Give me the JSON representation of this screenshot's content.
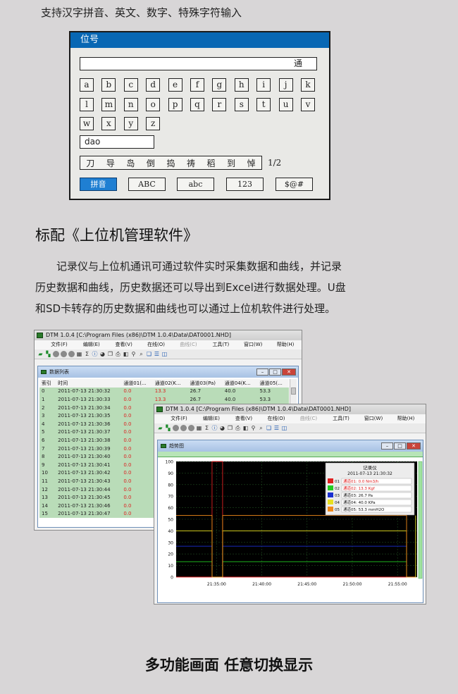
{
  "top_caption": "支持汉字拼音、英文、数字、特殊字符输入",
  "keyboard": {
    "title": "位号",
    "input_value": "通",
    "row1": [
      "a",
      "b",
      "c",
      "d",
      "e",
      "f",
      "g",
      "h",
      "i",
      "j",
      "k"
    ],
    "row2": [
      "l",
      "m",
      "n",
      "o",
      "p",
      "q",
      "r",
      "s",
      "t",
      "u",
      "v"
    ],
    "row3": [
      "w",
      "x",
      "y",
      "z"
    ],
    "pinyin": "dao",
    "candidates": [
      "刀",
      "导",
      "岛",
      "倒",
      "捣",
      "祷",
      "稻",
      "到",
      "悼"
    ],
    "page": "1/2",
    "modes": [
      "拼音",
      "ABC",
      "abc",
      "123",
      "$@#"
    ],
    "active_mode": "拼音"
  },
  "section_title": "标配《上位机管理软件》",
  "paragraph_lines": [
    "　　记录仪与上位机通讯可通过软件实时采集数据和曲线，并记录",
    "历史数据和曲线，历史数据还可以导出到Excel进行数据处理。U盘",
    "和SD卡转存的历史数据和曲线也可以通过上位机软件进行处理。"
  ],
  "app": {
    "title": "DTM 1.0.4 [C:\\Program Files (x86)\\DTM 1.0.4\\Data\\DAT0001.NHD]",
    "menus": [
      "文件(F)",
      "编辑(E)",
      "查看(V)",
      "在线(O)",
      "曲线(C)",
      "工具(T)",
      "窗口(W)",
      "帮助(H)"
    ],
    "dim_menu": "曲线(C)"
  },
  "table_window": {
    "title": "数据列表",
    "headers": [
      "索引",
      "时间",
      "通道01(...",
      "通道02(K...",
      "通道03(Pa)",
      "通道04(K...",
      "通道05(..."
    ],
    "rows": [
      [
        "0",
        "2011-07-13 21:30:32",
        "0.0",
        "13.3",
        "26.7",
        "40.0",
        "53.3"
      ],
      [
        "1",
        "2011-07-13 21:30:33",
        "0.0",
        "13.3",
        "26.7",
        "40.0",
        "53.3"
      ],
      [
        "2",
        "2011-07-13 21:30:34",
        "0.0",
        "",
        "",
        "",
        ""
      ],
      [
        "3",
        "2011-07-13 21:30:35",
        "0.0",
        "",
        "",
        "",
        ""
      ],
      [
        "4",
        "2011-07-13 21:30:36",
        "0.0",
        "",
        "",
        "",
        ""
      ],
      [
        "5",
        "2011-07-13 21:30:37",
        "0.0",
        "",
        "",
        "",
        ""
      ],
      [
        "6",
        "2011-07-13 21:30:38",
        "0.0",
        "",
        "",
        "",
        ""
      ],
      [
        "7",
        "2011-07-13 21:30:39",
        "0.0",
        "",
        "",
        "",
        ""
      ],
      [
        "8",
        "2011-07-13 21:30:40",
        "0.0",
        "",
        "",
        "",
        ""
      ],
      [
        "9",
        "2011-07-13 21:30:41",
        "0.0",
        "",
        "",
        "",
        ""
      ],
      [
        "10",
        "2011-07-13 21:30:42",
        "0.0",
        "",
        "",
        "",
        ""
      ],
      [
        "11",
        "2011-07-13 21:30:43",
        "0.0",
        "",
        "",
        "",
        ""
      ],
      [
        "12",
        "2011-07-13 21:30:44",
        "0.0",
        "",
        "",
        "",
        ""
      ],
      [
        "13",
        "2011-07-13 21:30:45",
        "0.0",
        "",
        "",
        "",
        ""
      ],
      [
        "14",
        "2011-07-13 21:30:46",
        "0.0",
        "",
        "",
        "",
        ""
      ],
      [
        "15",
        "2011-07-13 21:30:47",
        "0.0",
        "",
        "",
        "",
        ""
      ]
    ]
  },
  "trend_window": {
    "title": "趋势图",
    "y_ticks": [
      "100",
      "90",
      "80",
      "70",
      "60",
      "50",
      "40",
      "30",
      "20",
      "10",
      "0"
    ],
    "x_ticks": [
      "21:35:00",
      "21:40:00",
      "21:45:00",
      "21:50:00",
      "21:55:00"
    ],
    "legend_title": "记录仪",
    "legend_time": "2011-07-13 21:30:32",
    "legend": [
      {
        "id": "01",
        "label": "通道01: 0.0 Nm3/h",
        "color": "#e02020",
        "text_color": "#e02020"
      },
      {
        "id": "02",
        "label": "通道02: 13.3 Kgf",
        "color": "#22cc22",
        "text_color": "#e02020"
      },
      {
        "id": "03",
        "label": "通道03: 26.7 Pa",
        "color": "#1a2fd0",
        "text_color": "#111111"
      },
      {
        "id": "04",
        "label": "通道04: 40.0 KPa",
        "color": "#e8e020",
        "text_color": "#111111"
      },
      {
        "id": "05",
        "label": "通道05: 53.3 mmH2O",
        "color": "#f08a1a",
        "text_color": "#111111"
      }
    ]
  },
  "chart_data": {
    "type": "line",
    "x": [
      "21:30:32",
      "21:31:30",
      "21:32:30",
      "21:33:30",
      "21:34:30",
      "21:35:00",
      "21:35:40",
      "21:36:30",
      "21:55:00",
      "21:56:00",
      "21:57:00"
    ],
    "xlabel": "",
    "ylabel": "",
    "ylim": [
      0,
      100
    ],
    "x_ticks": [
      "21:35:00",
      "21:40:00",
      "21:45:00",
      "21:50:00",
      "21:55:00"
    ],
    "series": [
      {
        "name": "通道01",
        "color": "#e02020",
        "values": [
          0,
          0,
          0,
          0,
          100,
          100,
          0,
          0,
          0,
          0,
          0
        ]
      },
      {
        "name": "通道02",
        "color": "#22cc22",
        "values": [
          13.3,
          13.3,
          13.3,
          13.3,
          0,
          0,
          13.3,
          13.3,
          13.3,
          0,
          0
        ]
      },
      {
        "name": "通道03",
        "color": "#1a2fd0",
        "values": [
          26.7,
          26.7,
          26.7,
          26.7,
          0,
          0,
          26.7,
          26.7,
          26.7,
          0,
          0
        ]
      },
      {
        "name": "通道04",
        "color": "#e8e020",
        "values": [
          40,
          40,
          40,
          40,
          0,
          0,
          40,
          40,
          40,
          0,
          53.3
        ]
      },
      {
        "name": "通道05",
        "color": "#f08a1a",
        "values": [
          53.3,
          53.3,
          53.3,
          53.3,
          0,
          0,
          53.3,
          53.3,
          53.3,
          0,
          0
        ]
      }
    ],
    "grid": true
  },
  "bottom_caption": "多功能画面  任意切换显示"
}
